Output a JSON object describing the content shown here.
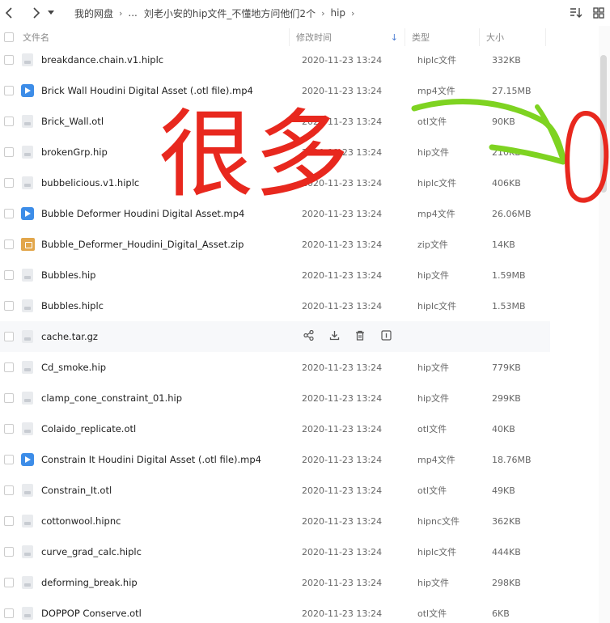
{
  "nav": {
    "breadcrumb": [
      "我的网盘",
      "...",
      "刘老小安的hip文件_不懂地方问他们2个",
      "hip"
    ]
  },
  "columns": {
    "name": "文件名",
    "time": "修改时间",
    "type": "类型",
    "size": "大小"
  },
  "files": [
    {
      "icon": "doc-icon",
      "name": "breakdance.chain.v1.hiplc",
      "time": "2020-11-23 13:24",
      "type": "hiplc文件",
      "size": "332KB"
    },
    {
      "icon": "video-icon",
      "name": "Brick Wall Houdini Digital Asset (.otl file).mp4",
      "time": "2020-11-23 13:24",
      "type": "mp4文件",
      "size": "27.15MB"
    },
    {
      "icon": "doc-icon",
      "name": "Brick_Wall.otl",
      "time": "2020-11-23 13:24",
      "type": "otl文件",
      "size": "90KB"
    },
    {
      "icon": "doc-icon",
      "name": "brokenGrp.hip",
      "time": "2020-11-23 13:24",
      "type": "hip文件",
      "size": "210KB"
    },
    {
      "icon": "doc-icon",
      "name": "bubbelicious.v1.hiplc",
      "time": "2020-11-23 13:24",
      "type": "hiplc文件",
      "size": "406KB"
    },
    {
      "icon": "video-icon",
      "name": "Bubble Deformer Houdini Digital Asset.mp4",
      "time": "2020-11-23 13:24",
      "type": "mp4文件",
      "size": "26.06MB"
    },
    {
      "icon": "zip-icon",
      "name": "Bubble_Deformer_Houdini_Digital_Asset.zip",
      "time": "2020-11-23 13:24",
      "type": "zip文件",
      "size": "14KB"
    },
    {
      "icon": "doc-icon",
      "name": "Bubbles.hip",
      "time": "2020-11-23 13:24",
      "type": "hip文件",
      "size": "1.59MB"
    },
    {
      "icon": "doc-icon",
      "name": "Bubbles.hiplc",
      "time": "2020-11-23 13:24",
      "type": "hiplc文件",
      "size": "1.53MB"
    },
    {
      "icon": "doc-icon",
      "name": "cache.tar.gz",
      "time": "",
      "type": "",
      "size": "",
      "hovered": true
    },
    {
      "icon": "doc-icon",
      "name": "Cd_smoke.hip",
      "time": "2020-11-23 13:24",
      "type": "hip文件",
      "size": "779KB"
    },
    {
      "icon": "doc-icon",
      "name": "clamp_cone_constraint_01.hip",
      "time": "2020-11-23 13:24",
      "type": "hip文件",
      "size": "299KB"
    },
    {
      "icon": "doc-icon",
      "name": "Colaido_replicate.otl",
      "time": "2020-11-23 13:24",
      "type": "otl文件",
      "size": "40KB"
    },
    {
      "icon": "video-icon",
      "name": "Constrain It  Houdini Digital Asset (.otl file).mp4",
      "time": "2020-11-23 13:24",
      "type": "mp4文件",
      "size": "18.76MB"
    },
    {
      "icon": "doc-icon",
      "name": "Constrain_It.otl",
      "time": "2020-11-23 13:24",
      "type": "otl文件",
      "size": "49KB"
    },
    {
      "icon": "doc-icon",
      "name": "cottonwool.hipnc",
      "time": "2020-11-23 13:24",
      "type": "hipnc文件",
      "size": "362KB"
    },
    {
      "icon": "doc-icon",
      "name": "curve_grad_calc.hiplc",
      "time": "2020-11-23 13:24",
      "type": "hiplc文件",
      "size": "444KB"
    },
    {
      "icon": "doc-icon",
      "name": "deforming_break.hip",
      "time": "2020-11-23 13:24",
      "type": "hip文件",
      "size": "298KB"
    },
    {
      "icon": "doc-icon",
      "name": "DOPPOP Conserve.otl",
      "time": "2020-11-23 13:24",
      "type": "otl文件",
      "size": "6KB"
    }
  ],
  "annotation": {
    "text": "很多",
    "color": "#e8281e",
    "arrow_color": "#7ed321"
  },
  "colors": {
    "accent": "#3d8de8",
    "hover_row": "#f7f8fa"
  }
}
